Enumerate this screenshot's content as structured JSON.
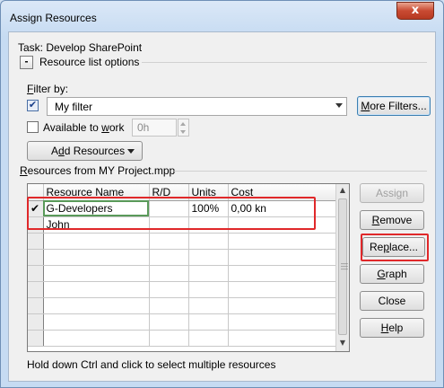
{
  "window": {
    "title": "Assign Resources",
    "close_glyph": "x"
  },
  "task": {
    "label": "Task:",
    "name": "Develop SharePoint"
  },
  "resource_list_options": {
    "toggle": "-",
    "label": "Resource list options"
  },
  "filter": {
    "label_prefix": "F",
    "label_rest": "ilter by:",
    "checked": true,
    "value": "My filter",
    "more_filters_prefix": "M",
    "more_filters_rest": "ore Filters..."
  },
  "available": {
    "label_pre": "Available to ",
    "label_u": "w",
    "label_post": "ork",
    "checked": false,
    "hours": "0h"
  },
  "add_resources": {
    "pre": "A",
    "u": "d",
    "post": "d Resources"
  },
  "resources_from": {
    "u": "R",
    "rest": "esources from MY Project.mpp"
  },
  "table": {
    "columns": [
      "Resource Name",
      "R/D",
      "Units",
      "Cost"
    ],
    "rows": [
      {
        "check": "✔",
        "name": "G-Developers",
        "rd": "",
        "units": "100%",
        "cost": "0,00 kn"
      },
      {
        "check": "",
        "name": "John",
        "rd": "",
        "units": "",
        "cost": ""
      },
      {
        "check": "",
        "name": "",
        "rd": "",
        "units": "",
        "cost": ""
      },
      {
        "check": "",
        "name": "",
        "rd": "",
        "units": "",
        "cost": ""
      },
      {
        "check": "",
        "name": "",
        "rd": "",
        "units": "",
        "cost": ""
      },
      {
        "check": "",
        "name": "",
        "rd": "",
        "units": "",
        "cost": ""
      },
      {
        "check": "",
        "name": "",
        "rd": "",
        "units": "",
        "cost": ""
      },
      {
        "check": "",
        "name": "",
        "rd": "",
        "units": "",
        "cost": ""
      },
      {
        "check": "",
        "name": "",
        "rd": "",
        "units": "",
        "cost": ""
      }
    ]
  },
  "buttons": {
    "assign": "Assign",
    "remove_u": "R",
    "remove_rest": "emove",
    "replace_pre": "Re",
    "replace_u": "p",
    "replace_post": "lace...",
    "graph_u": "G",
    "graph_rest": "raph",
    "close": "Close",
    "help_u": "H",
    "help_rest": "elp"
  },
  "status": "Hold down Ctrl and click to select multiple resources",
  "colors": {
    "highlight": "#e0282a",
    "accent_border": "#3c7fb1"
  }
}
